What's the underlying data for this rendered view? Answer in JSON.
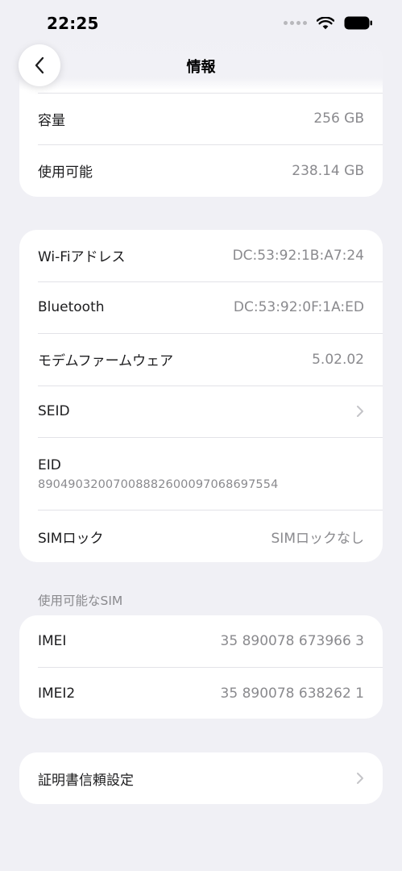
{
  "status_bar": {
    "time": "22:25"
  },
  "nav": {
    "title": "情報"
  },
  "storage": [
    {
      "label": "容量",
      "value": "256 GB"
    },
    {
      "label": "使用可能",
      "value": "238.14 GB"
    }
  ],
  "network": {
    "wifi": {
      "label": "Wi-Fiアドレス",
      "value": "DC:53:92:1B:A7:24"
    },
    "bluetooth": {
      "label": "Bluetooth",
      "value": "DC:53:92:0F:1A:ED"
    },
    "modem": {
      "label": "モデムファームウェア",
      "value": "5.02.02"
    },
    "seid": {
      "label": "SEID"
    },
    "eid": {
      "label": "EID",
      "value": "89049032007008882600097068697554"
    },
    "simlock": {
      "label": "SIMロック",
      "value": "SIMロックなし"
    }
  },
  "sim_section": {
    "header": "使用可能なSIM",
    "imei": {
      "label": "IMEI",
      "value": "35 890078 673966 3"
    },
    "imei2": {
      "label": "IMEI2",
      "value": "35 890078 638262 1"
    }
  },
  "certificate": {
    "label": "証明書信頼設定"
  },
  "icons": {
    "back": "chevron-left-icon",
    "disclosure": "chevron-right-icon",
    "wifi": "wifi-icon",
    "battery": "battery-icon",
    "signal": "signal-dots-icon"
  },
  "colors": {
    "background": "#f0f0f5",
    "card": "#ffffff",
    "secondary_text": "#8a8a8e",
    "separator": "#e3e3e8"
  }
}
